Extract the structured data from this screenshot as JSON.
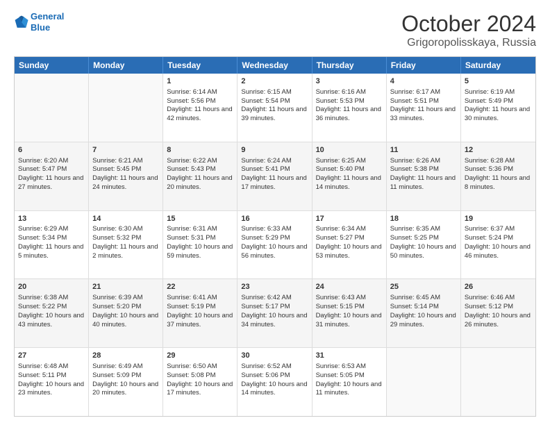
{
  "logo": {
    "line1": "General",
    "line2": "Blue"
  },
  "title": "October 2024",
  "location": "Grigoropolisskaya, Russia",
  "days_of_week": [
    "Sunday",
    "Monday",
    "Tuesday",
    "Wednesday",
    "Thursday",
    "Friday",
    "Saturday"
  ],
  "rows": [
    [
      {
        "day": "",
        "sunrise": "",
        "sunset": "",
        "daylight": "",
        "empty": true
      },
      {
        "day": "",
        "sunrise": "",
        "sunset": "",
        "daylight": "",
        "empty": true
      },
      {
        "day": "1",
        "sunrise": "Sunrise: 6:14 AM",
        "sunset": "Sunset: 5:56 PM",
        "daylight": "Daylight: 11 hours and 42 minutes."
      },
      {
        "day": "2",
        "sunrise": "Sunrise: 6:15 AM",
        "sunset": "Sunset: 5:54 PM",
        "daylight": "Daylight: 11 hours and 39 minutes."
      },
      {
        "day": "3",
        "sunrise": "Sunrise: 6:16 AM",
        "sunset": "Sunset: 5:53 PM",
        "daylight": "Daylight: 11 hours and 36 minutes."
      },
      {
        "day": "4",
        "sunrise": "Sunrise: 6:17 AM",
        "sunset": "Sunset: 5:51 PM",
        "daylight": "Daylight: 11 hours and 33 minutes."
      },
      {
        "day": "5",
        "sunrise": "Sunrise: 6:19 AM",
        "sunset": "Sunset: 5:49 PM",
        "daylight": "Daylight: 11 hours and 30 minutes."
      }
    ],
    [
      {
        "day": "6",
        "sunrise": "Sunrise: 6:20 AM",
        "sunset": "Sunset: 5:47 PM",
        "daylight": "Daylight: 11 hours and 27 minutes."
      },
      {
        "day": "7",
        "sunrise": "Sunrise: 6:21 AM",
        "sunset": "Sunset: 5:45 PM",
        "daylight": "Daylight: 11 hours and 24 minutes."
      },
      {
        "day": "8",
        "sunrise": "Sunrise: 6:22 AM",
        "sunset": "Sunset: 5:43 PM",
        "daylight": "Daylight: 11 hours and 20 minutes."
      },
      {
        "day": "9",
        "sunrise": "Sunrise: 6:24 AM",
        "sunset": "Sunset: 5:41 PM",
        "daylight": "Daylight: 11 hours and 17 minutes."
      },
      {
        "day": "10",
        "sunrise": "Sunrise: 6:25 AM",
        "sunset": "Sunset: 5:40 PM",
        "daylight": "Daylight: 11 hours and 14 minutes."
      },
      {
        "day": "11",
        "sunrise": "Sunrise: 6:26 AM",
        "sunset": "Sunset: 5:38 PM",
        "daylight": "Daylight: 11 hours and 11 minutes."
      },
      {
        "day": "12",
        "sunrise": "Sunrise: 6:28 AM",
        "sunset": "Sunset: 5:36 PM",
        "daylight": "Daylight: 11 hours and 8 minutes."
      }
    ],
    [
      {
        "day": "13",
        "sunrise": "Sunrise: 6:29 AM",
        "sunset": "Sunset: 5:34 PM",
        "daylight": "Daylight: 11 hours and 5 minutes."
      },
      {
        "day": "14",
        "sunrise": "Sunrise: 6:30 AM",
        "sunset": "Sunset: 5:32 PM",
        "daylight": "Daylight: 11 hours and 2 minutes."
      },
      {
        "day": "15",
        "sunrise": "Sunrise: 6:31 AM",
        "sunset": "Sunset: 5:31 PM",
        "daylight": "Daylight: 10 hours and 59 minutes."
      },
      {
        "day": "16",
        "sunrise": "Sunrise: 6:33 AM",
        "sunset": "Sunset: 5:29 PM",
        "daylight": "Daylight: 10 hours and 56 minutes."
      },
      {
        "day": "17",
        "sunrise": "Sunrise: 6:34 AM",
        "sunset": "Sunset: 5:27 PM",
        "daylight": "Daylight: 10 hours and 53 minutes."
      },
      {
        "day": "18",
        "sunrise": "Sunrise: 6:35 AM",
        "sunset": "Sunset: 5:25 PM",
        "daylight": "Daylight: 10 hours and 50 minutes."
      },
      {
        "day": "19",
        "sunrise": "Sunrise: 6:37 AM",
        "sunset": "Sunset: 5:24 PM",
        "daylight": "Daylight: 10 hours and 46 minutes."
      }
    ],
    [
      {
        "day": "20",
        "sunrise": "Sunrise: 6:38 AM",
        "sunset": "Sunset: 5:22 PM",
        "daylight": "Daylight: 10 hours and 43 minutes."
      },
      {
        "day": "21",
        "sunrise": "Sunrise: 6:39 AM",
        "sunset": "Sunset: 5:20 PM",
        "daylight": "Daylight: 10 hours and 40 minutes."
      },
      {
        "day": "22",
        "sunrise": "Sunrise: 6:41 AM",
        "sunset": "Sunset: 5:19 PM",
        "daylight": "Daylight: 10 hours and 37 minutes."
      },
      {
        "day": "23",
        "sunrise": "Sunrise: 6:42 AM",
        "sunset": "Sunset: 5:17 PM",
        "daylight": "Daylight: 10 hours and 34 minutes."
      },
      {
        "day": "24",
        "sunrise": "Sunrise: 6:43 AM",
        "sunset": "Sunset: 5:15 PM",
        "daylight": "Daylight: 10 hours and 31 minutes."
      },
      {
        "day": "25",
        "sunrise": "Sunrise: 6:45 AM",
        "sunset": "Sunset: 5:14 PM",
        "daylight": "Daylight: 10 hours and 29 minutes."
      },
      {
        "day": "26",
        "sunrise": "Sunrise: 6:46 AM",
        "sunset": "Sunset: 5:12 PM",
        "daylight": "Daylight: 10 hours and 26 minutes."
      }
    ],
    [
      {
        "day": "27",
        "sunrise": "Sunrise: 6:48 AM",
        "sunset": "Sunset: 5:11 PM",
        "daylight": "Daylight: 10 hours and 23 minutes."
      },
      {
        "day": "28",
        "sunrise": "Sunrise: 6:49 AM",
        "sunset": "Sunset: 5:09 PM",
        "daylight": "Daylight: 10 hours and 20 minutes."
      },
      {
        "day": "29",
        "sunrise": "Sunrise: 6:50 AM",
        "sunset": "Sunset: 5:08 PM",
        "daylight": "Daylight: 10 hours and 17 minutes."
      },
      {
        "day": "30",
        "sunrise": "Sunrise: 6:52 AM",
        "sunset": "Sunset: 5:06 PM",
        "daylight": "Daylight: 10 hours and 14 minutes."
      },
      {
        "day": "31",
        "sunrise": "Sunrise: 6:53 AM",
        "sunset": "Sunset: 5:05 PM",
        "daylight": "Daylight: 10 hours and 11 minutes."
      },
      {
        "day": "",
        "sunrise": "",
        "sunset": "",
        "daylight": "",
        "empty": true
      },
      {
        "day": "",
        "sunrise": "",
        "sunset": "",
        "daylight": "",
        "empty": true
      }
    ]
  ]
}
